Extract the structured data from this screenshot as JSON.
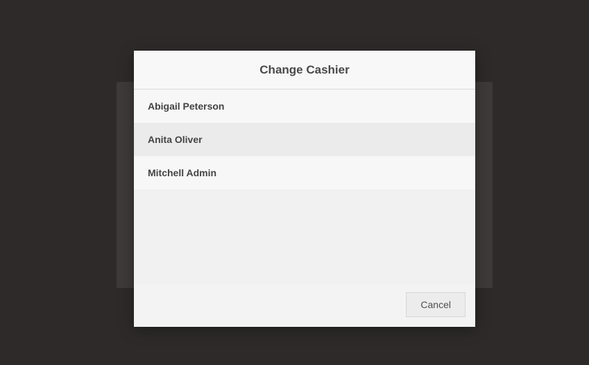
{
  "modal": {
    "title": "Change Cashier",
    "cashiers": [
      {
        "name": "Abigail Peterson"
      },
      {
        "name": "Anita Oliver"
      },
      {
        "name": "Mitchell Admin"
      }
    ],
    "cancel_label": "Cancel"
  }
}
